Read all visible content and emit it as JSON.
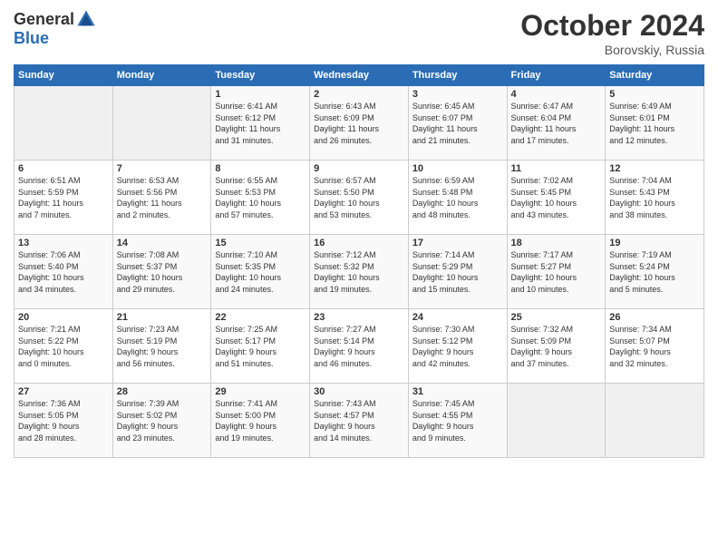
{
  "logo": {
    "general": "General",
    "blue": "Blue"
  },
  "title": "October 2024",
  "location": "Borovskiy, Russia",
  "days_header": [
    "Sunday",
    "Monday",
    "Tuesday",
    "Wednesday",
    "Thursday",
    "Friday",
    "Saturday"
  ],
  "weeks": [
    [
      {
        "num": "",
        "info": ""
      },
      {
        "num": "",
        "info": ""
      },
      {
        "num": "1",
        "info": "Sunrise: 6:41 AM\nSunset: 6:12 PM\nDaylight: 11 hours\nand 31 minutes."
      },
      {
        "num": "2",
        "info": "Sunrise: 6:43 AM\nSunset: 6:09 PM\nDaylight: 11 hours\nand 26 minutes."
      },
      {
        "num": "3",
        "info": "Sunrise: 6:45 AM\nSunset: 6:07 PM\nDaylight: 11 hours\nand 21 minutes."
      },
      {
        "num": "4",
        "info": "Sunrise: 6:47 AM\nSunset: 6:04 PM\nDaylight: 11 hours\nand 17 minutes."
      },
      {
        "num": "5",
        "info": "Sunrise: 6:49 AM\nSunset: 6:01 PM\nDaylight: 11 hours\nand 12 minutes."
      }
    ],
    [
      {
        "num": "6",
        "info": "Sunrise: 6:51 AM\nSunset: 5:59 PM\nDaylight: 11 hours\nand 7 minutes."
      },
      {
        "num": "7",
        "info": "Sunrise: 6:53 AM\nSunset: 5:56 PM\nDaylight: 11 hours\nand 2 minutes."
      },
      {
        "num": "8",
        "info": "Sunrise: 6:55 AM\nSunset: 5:53 PM\nDaylight: 10 hours\nand 57 minutes."
      },
      {
        "num": "9",
        "info": "Sunrise: 6:57 AM\nSunset: 5:50 PM\nDaylight: 10 hours\nand 53 minutes."
      },
      {
        "num": "10",
        "info": "Sunrise: 6:59 AM\nSunset: 5:48 PM\nDaylight: 10 hours\nand 48 minutes."
      },
      {
        "num": "11",
        "info": "Sunrise: 7:02 AM\nSunset: 5:45 PM\nDaylight: 10 hours\nand 43 minutes."
      },
      {
        "num": "12",
        "info": "Sunrise: 7:04 AM\nSunset: 5:43 PM\nDaylight: 10 hours\nand 38 minutes."
      }
    ],
    [
      {
        "num": "13",
        "info": "Sunrise: 7:06 AM\nSunset: 5:40 PM\nDaylight: 10 hours\nand 34 minutes."
      },
      {
        "num": "14",
        "info": "Sunrise: 7:08 AM\nSunset: 5:37 PM\nDaylight: 10 hours\nand 29 minutes."
      },
      {
        "num": "15",
        "info": "Sunrise: 7:10 AM\nSunset: 5:35 PM\nDaylight: 10 hours\nand 24 minutes."
      },
      {
        "num": "16",
        "info": "Sunrise: 7:12 AM\nSunset: 5:32 PM\nDaylight: 10 hours\nand 19 minutes."
      },
      {
        "num": "17",
        "info": "Sunrise: 7:14 AM\nSunset: 5:29 PM\nDaylight: 10 hours\nand 15 minutes."
      },
      {
        "num": "18",
        "info": "Sunrise: 7:17 AM\nSunset: 5:27 PM\nDaylight: 10 hours\nand 10 minutes."
      },
      {
        "num": "19",
        "info": "Sunrise: 7:19 AM\nSunset: 5:24 PM\nDaylight: 10 hours\nand 5 minutes."
      }
    ],
    [
      {
        "num": "20",
        "info": "Sunrise: 7:21 AM\nSunset: 5:22 PM\nDaylight: 10 hours\nand 0 minutes."
      },
      {
        "num": "21",
        "info": "Sunrise: 7:23 AM\nSunset: 5:19 PM\nDaylight: 9 hours\nand 56 minutes."
      },
      {
        "num": "22",
        "info": "Sunrise: 7:25 AM\nSunset: 5:17 PM\nDaylight: 9 hours\nand 51 minutes."
      },
      {
        "num": "23",
        "info": "Sunrise: 7:27 AM\nSunset: 5:14 PM\nDaylight: 9 hours\nand 46 minutes."
      },
      {
        "num": "24",
        "info": "Sunrise: 7:30 AM\nSunset: 5:12 PM\nDaylight: 9 hours\nand 42 minutes."
      },
      {
        "num": "25",
        "info": "Sunrise: 7:32 AM\nSunset: 5:09 PM\nDaylight: 9 hours\nand 37 minutes."
      },
      {
        "num": "26",
        "info": "Sunrise: 7:34 AM\nSunset: 5:07 PM\nDaylight: 9 hours\nand 32 minutes."
      }
    ],
    [
      {
        "num": "27",
        "info": "Sunrise: 7:36 AM\nSunset: 5:05 PM\nDaylight: 9 hours\nand 28 minutes."
      },
      {
        "num": "28",
        "info": "Sunrise: 7:39 AM\nSunset: 5:02 PM\nDaylight: 9 hours\nand 23 minutes."
      },
      {
        "num": "29",
        "info": "Sunrise: 7:41 AM\nSunset: 5:00 PM\nDaylight: 9 hours\nand 19 minutes."
      },
      {
        "num": "30",
        "info": "Sunrise: 7:43 AM\nSunset: 4:57 PM\nDaylight: 9 hours\nand 14 minutes."
      },
      {
        "num": "31",
        "info": "Sunrise: 7:45 AM\nSunset: 4:55 PM\nDaylight: 9 hours\nand 9 minutes."
      },
      {
        "num": "",
        "info": ""
      },
      {
        "num": "",
        "info": ""
      }
    ]
  ]
}
